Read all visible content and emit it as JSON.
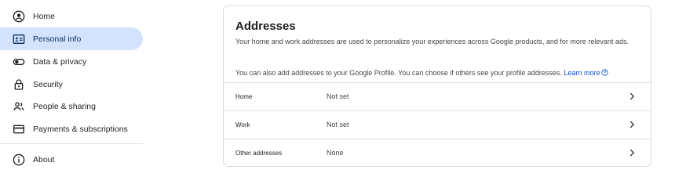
{
  "sidebar": {
    "items": [
      {
        "label": "Home",
        "icon": "account-circle-icon"
      },
      {
        "label": "Personal info",
        "icon": "id-card-icon",
        "active": true
      },
      {
        "label": "Data & privacy",
        "icon": "toggle-icon"
      },
      {
        "label": "Security",
        "icon": "lock-icon"
      },
      {
        "label": "People & sharing",
        "icon": "people-icon"
      },
      {
        "label": "Payments & subscriptions",
        "icon": "credit-card-icon"
      }
    ],
    "about_label": "About"
  },
  "card": {
    "title": "Addresses",
    "description": "Your home and work addresses are used to personalize your experiences across Google products, and for more relevant ads.",
    "profile_text": "You can also add addresses to your Google Profile. You can choose if others see your profile addresses.",
    "learn_more": "Learn more",
    "rows": [
      {
        "label": "Home",
        "value": "Not set"
      },
      {
        "label": "Work",
        "value": "Not set"
      },
      {
        "label": "Other addresses",
        "value": "None"
      }
    ]
  },
  "colors": {
    "active_bg": "#d3e3fd",
    "link": "#0b57d0",
    "border": "#dadce0"
  }
}
